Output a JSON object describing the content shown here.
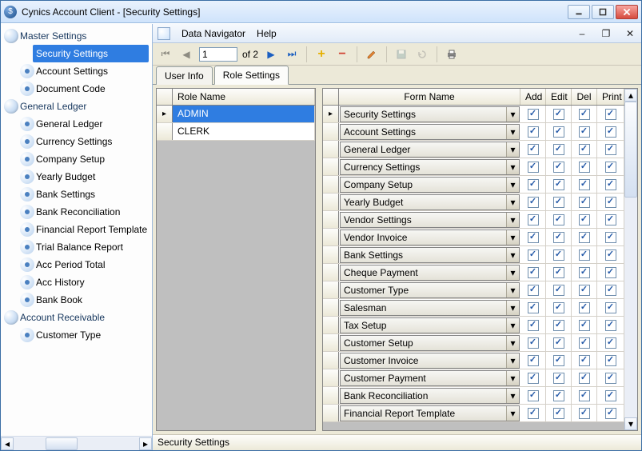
{
  "window": {
    "title": "Cynics Account Client - [Security Settings]"
  },
  "menubar": {
    "dataNavigator": "Data Navigator",
    "help": "Help"
  },
  "navigator": {
    "page_current": "1",
    "page_total": "of 2"
  },
  "tabs": {
    "userInfo": "User Info",
    "roleSettings": "Role Settings"
  },
  "sidebar": {
    "sections": [
      {
        "label": "Master Settings",
        "items": [
          {
            "label": "Security Settings",
            "selected": true
          },
          {
            "label": "Account Settings"
          },
          {
            "label": "Document Code"
          }
        ]
      },
      {
        "label": "General Ledger",
        "items": [
          {
            "label": "General Ledger"
          },
          {
            "label": "Currency Settings"
          },
          {
            "label": "Company Setup"
          },
          {
            "label": "Yearly Budget"
          },
          {
            "label": "Bank Settings"
          },
          {
            "label": "Bank Reconciliation"
          },
          {
            "label": "Financial Report Template"
          },
          {
            "label": "Trial Balance Report"
          },
          {
            "label": "Acc Period Total"
          },
          {
            "label": "Acc History"
          },
          {
            "label": "Bank Book"
          }
        ]
      },
      {
        "label": "Account Receivable",
        "items": [
          {
            "label": "Customer Type"
          }
        ]
      }
    ]
  },
  "roleGrid": {
    "header": "Role Name",
    "rows": [
      {
        "name": "ADMIN",
        "selected": true
      },
      {
        "name": "CLERK"
      }
    ]
  },
  "formGrid": {
    "headers": {
      "form": "Form Name",
      "add": "Add",
      "edit": "Edit",
      "del": "Del",
      "print": "Print"
    },
    "rows": [
      {
        "form": "Security Settings",
        "add": true,
        "edit": true,
        "del": true,
        "print": true,
        "active": true
      },
      {
        "form": "Account Settings",
        "add": true,
        "edit": true,
        "del": true,
        "print": true
      },
      {
        "form": "General Ledger",
        "add": true,
        "edit": true,
        "del": true,
        "print": true
      },
      {
        "form": "Currency Settings",
        "add": true,
        "edit": true,
        "del": true,
        "print": true
      },
      {
        "form": "Company Setup",
        "add": true,
        "edit": true,
        "del": true,
        "print": true
      },
      {
        "form": "Yearly Budget",
        "add": true,
        "edit": true,
        "del": true,
        "print": true
      },
      {
        "form": "Vendor Settings",
        "add": true,
        "edit": true,
        "del": true,
        "print": true
      },
      {
        "form": "Vendor Invoice",
        "add": true,
        "edit": true,
        "del": true,
        "print": true
      },
      {
        "form": "Bank Settings",
        "add": true,
        "edit": true,
        "del": true,
        "print": true
      },
      {
        "form": "Cheque Payment",
        "add": true,
        "edit": true,
        "del": true,
        "print": true
      },
      {
        "form": "Customer Type",
        "add": true,
        "edit": true,
        "del": true,
        "print": true
      },
      {
        "form": "Salesman",
        "add": true,
        "edit": true,
        "del": true,
        "print": true
      },
      {
        "form": "Tax Setup",
        "add": true,
        "edit": true,
        "del": true,
        "print": true
      },
      {
        "form": "Customer Setup",
        "add": true,
        "edit": true,
        "del": true,
        "print": true
      },
      {
        "form": "Customer Invoice",
        "add": true,
        "edit": true,
        "del": true,
        "print": true
      },
      {
        "form": "Customer Payment",
        "add": true,
        "edit": true,
        "del": true,
        "print": true
      },
      {
        "form": "Bank Reconciliation",
        "add": true,
        "edit": true,
        "del": true,
        "print": true
      },
      {
        "form": "Financial Report Template",
        "add": true,
        "edit": true,
        "del": true,
        "print": true
      }
    ]
  },
  "statusbar": {
    "text": "Security Settings"
  }
}
